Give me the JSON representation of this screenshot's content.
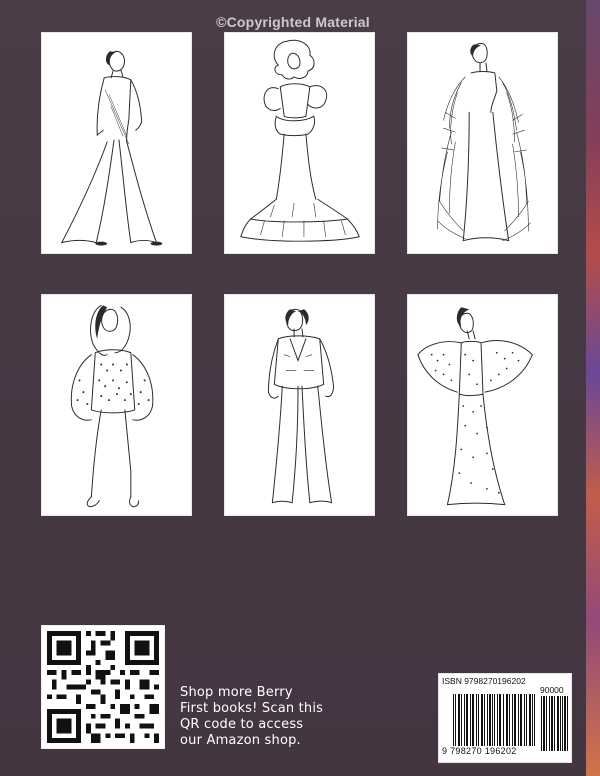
{
  "watermark": {
    "text": "©Copyrighted Material"
  },
  "gallery": {
    "items": [
      {
        "illustration": "figure in flared sequined jumpsuit"
      },
      {
        "illustration": "figure in ruffled tiered gown"
      },
      {
        "illustration": "figure in feathered evening gown"
      },
      {
        "illustration": "figure in sequined puff-sleeve mini dress"
      },
      {
        "illustration": "figure in tailored jacket and wide trousers"
      },
      {
        "illustration": "figure in beaded kimono-sleeve gown"
      }
    ]
  },
  "promo": {
    "text": "Shop more Berry First books! Scan this QR code to access our Amazon shop."
  },
  "barcode": {
    "isbn_label": "ISBN 9798270196202",
    "addon": "90000",
    "digits": "9 798270 196202"
  },
  "colors": {
    "background": "#4a3c46",
    "panel": "#ffffff",
    "text": "#ffffff"
  }
}
